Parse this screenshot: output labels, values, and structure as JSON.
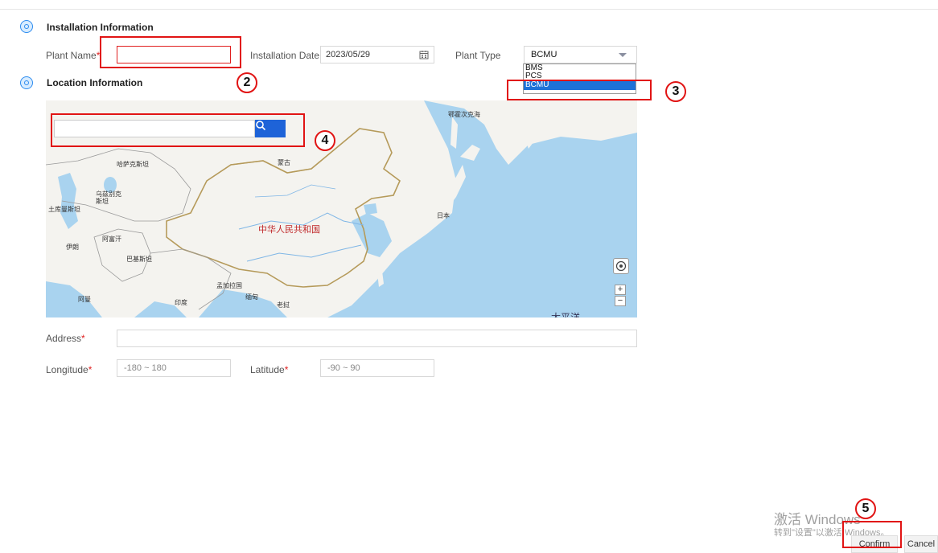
{
  "installation": {
    "section_title": "Installation Information",
    "plant_name_label": "Plant Name",
    "plant_name_value": "",
    "installation_date_label": "Installation Date",
    "installation_date_value": "2023/05/29",
    "plant_type_label": "Plant Type",
    "plant_type_value": "BCMU",
    "plant_type_options": [
      "BMS",
      "PCS",
      "BCMU"
    ],
    "required_mark": "*"
  },
  "location": {
    "section_title": "Location Information",
    "address_label": "Address",
    "address_value": "",
    "longitude_label": "Longitude",
    "longitude_placeholder": "-180 ~ 180",
    "latitude_label": "Latitude",
    "latitude_placeholder": "-90 ~ 90"
  },
  "map": {
    "search_value": "",
    "search_icon": "search-icon",
    "locate_icon": "locate-icon",
    "zoom_in": "+",
    "zoom_out": "−",
    "labels": {
      "china": "中华人民共和国",
      "mongolia": "蒙古",
      "kazakhstan": "哈萨克斯坦",
      "uzbekistan": "乌兹别克\n斯坦",
      "turkmenistan": "土库曼斯坦",
      "afghanistan": "阿富汗",
      "iran": "伊朗",
      "pakistan": "巴基斯坦",
      "india": "印度",
      "bangladesh": "孟加拉国",
      "myanmar": "缅甸",
      "laos": "老挝",
      "oman": "阿曼",
      "japan": "日本",
      "okhotsk": "鄂霍次克海",
      "pacific": "太平洋"
    }
  },
  "annotations": [
    "2",
    "3",
    "4",
    "5"
  ],
  "footer": {
    "confirm_label": "Confirm",
    "cancel_label": "Cancel",
    "watermark_line1": "激活 Windows",
    "watermark_line2": "转到\"设置\"以激活 Windows。"
  },
  "colors": {
    "accent": "#1e63d8",
    "annotation_red": "#e11414",
    "required_red": "#e02020",
    "map_water": "#a9d3ef",
    "map_land": "#f4f3ef"
  }
}
